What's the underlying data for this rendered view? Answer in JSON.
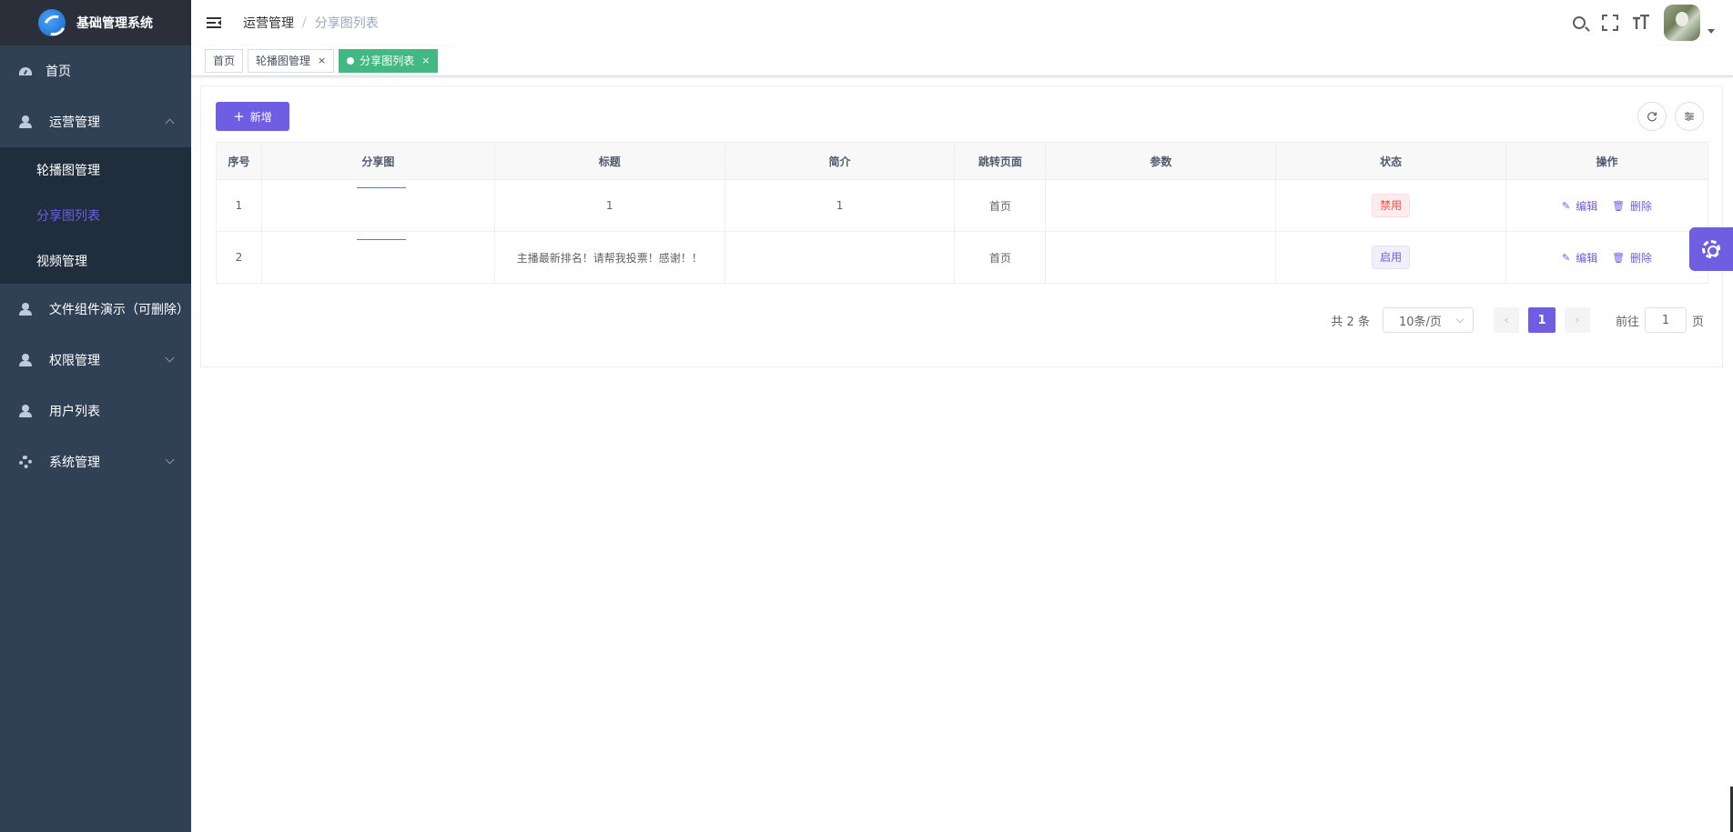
{
  "app": {
    "title": "基础管理系统"
  },
  "sidebar": {
    "items": [
      {
        "label": "首页",
        "icon": "dashboard-icon"
      },
      {
        "label": "运营管理",
        "icon": "user-icon",
        "expanded": true,
        "children": [
          {
            "label": "轮播图管理"
          },
          {
            "label": "分享图列表",
            "active": true
          },
          {
            "label": "视频管理"
          }
        ]
      },
      {
        "label": "文件组件演示（可删除）",
        "icon": "user-icon"
      },
      {
        "label": "权限管理",
        "icon": "user-icon"
      },
      {
        "label": "用户列表",
        "icon": "user-icon"
      },
      {
        "label": "系统管理",
        "icon": "gear-icon"
      }
    ]
  },
  "navbar": {
    "breadcrumb": [
      "运营管理",
      "分享图列表"
    ],
    "separator": "/",
    "font_size_glyph": "T"
  },
  "tags": [
    {
      "label": "首页"
    },
    {
      "label": "轮播图管理",
      "close": "×"
    },
    {
      "label": "分享图列表",
      "close": "×",
      "active": true
    }
  ],
  "toolbar": {
    "add_label": "新增",
    "add_plus": "+"
  },
  "table": {
    "headers": [
      "序号",
      "分享图",
      "标题",
      "简介",
      "跳转页面",
      "参数",
      "状态",
      "操作"
    ],
    "rows": [
      {
        "index": "1",
        "title": "1",
        "intro": "1",
        "page": "首页",
        "params": "",
        "status": "禁用",
        "status_type": "danger"
      },
      {
        "index": "2",
        "title": "主播最新排名！请帮我投票！感谢！！",
        "intro": "",
        "page": "首页",
        "params": "",
        "status": "启用",
        "status_type": "primary"
      }
    ],
    "actions": {
      "edit": "编辑",
      "delete": "删除"
    }
  },
  "pagination": {
    "total_text": "共 2 条",
    "page_size": "10条/页",
    "current_page": "1",
    "goto_label": "前往",
    "goto_value": "1",
    "page_suffix": "页"
  },
  "colors": {
    "primary": "#6f5de2",
    "sidebar": "#304156",
    "tag_active": "#42b983",
    "danger": "#ff4949"
  }
}
